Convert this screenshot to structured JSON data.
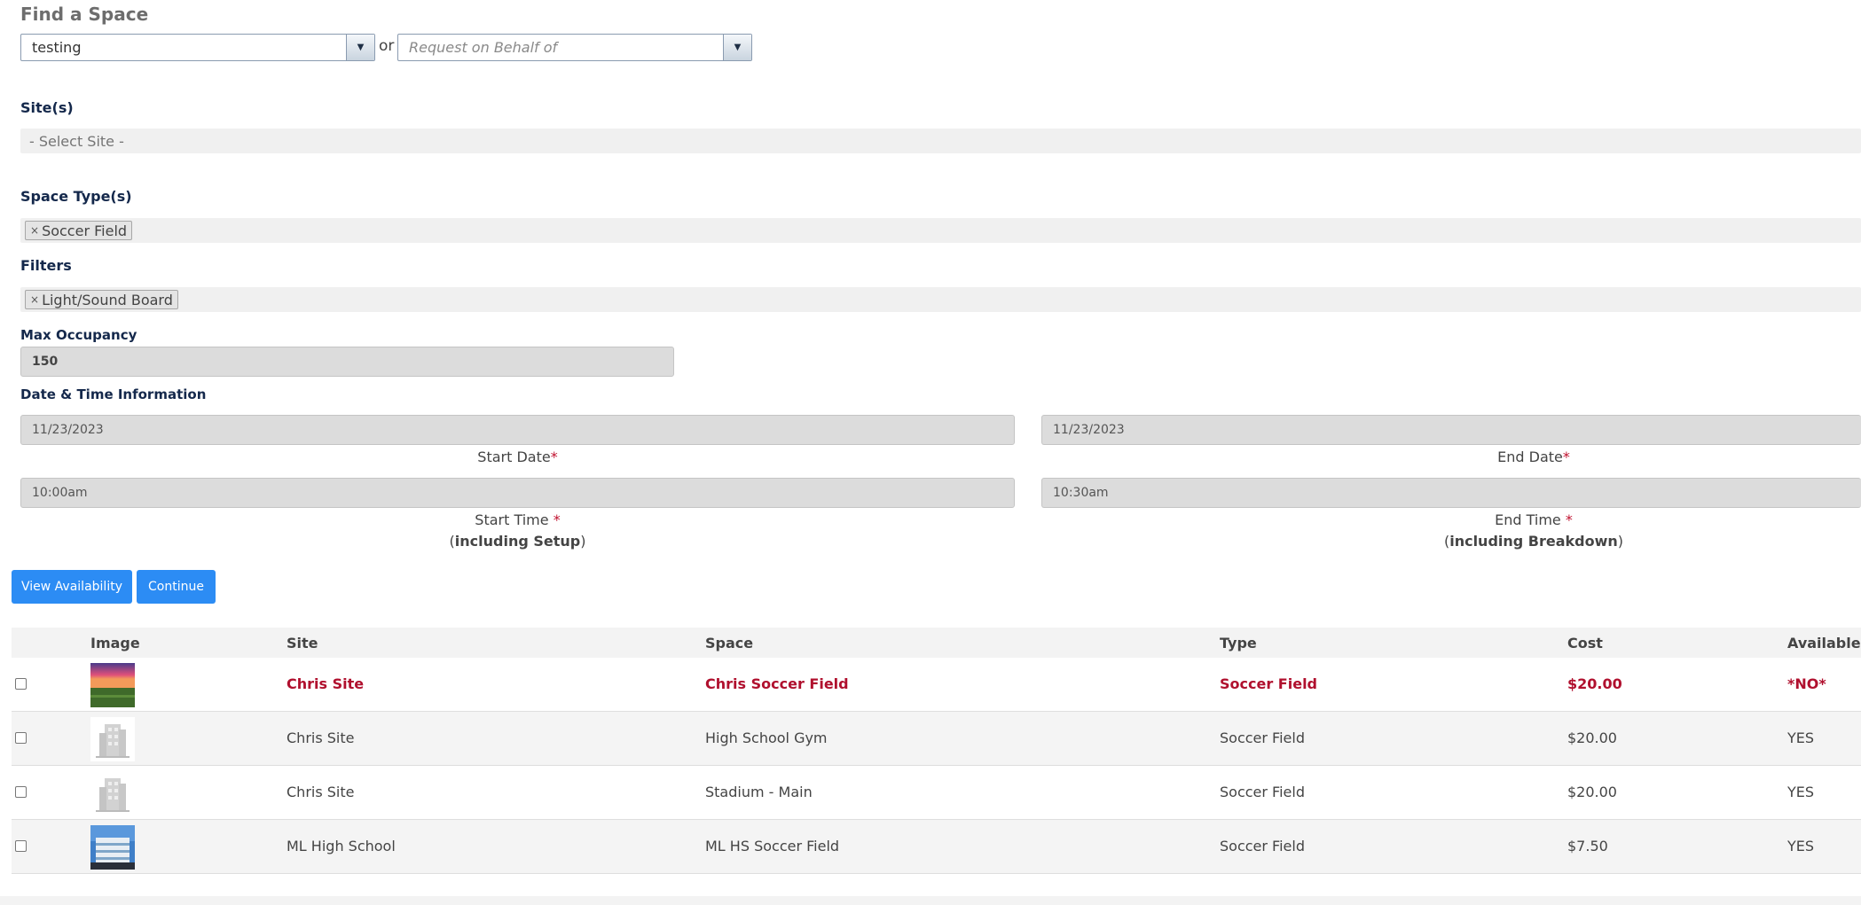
{
  "page_title": "Find a Space",
  "requester": {
    "value": "testing",
    "or_text": "or",
    "behalf_placeholder": "Request on Behalf of"
  },
  "sites": {
    "label": "Site(s)",
    "placeholder": "- Select Site -"
  },
  "space_types": {
    "label": "Space Type(s)",
    "chips": [
      "Soccer Field"
    ]
  },
  "filters": {
    "label": "Filters",
    "chips": [
      "Light/Sound Board"
    ]
  },
  "max_occupancy": {
    "label": "Max Occupancy",
    "value": "150"
  },
  "datetime": {
    "label": "Date & Time Information",
    "start_date": "11/23/2023",
    "end_date": "11/23/2023",
    "start_date_label": "Start Date",
    "end_date_label": "End Date",
    "start_time": "10:00am",
    "end_time": "10:30am",
    "start_time_label": "Start Time ",
    "end_time_label": "End Time ",
    "start_time_note": "including Setup",
    "end_time_note": "including Breakdown",
    "required_mark": "*"
  },
  "buttons": {
    "view_availability": "View Availability",
    "continue": "Continue"
  },
  "table": {
    "headers": {
      "image": "Image",
      "site": "Site",
      "space": "Space",
      "type": "Type",
      "cost": "Cost",
      "available": "Available"
    },
    "rows": [
      {
        "site": "Chris Site",
        "space": "Chris Soccer Field",
        "type": "Soccer Field",
        "cost": "$20.00",
        "available": "*NO*",
        "image": "sunset-field-photo"
      },
      {
        "site": "Chris Site",
        "space": "High School Gym",
        "type": "Soccer Field",
        "cost": "$20.00",
        "available": "YES",
        "image": "building-placeholder-icon"
      },
      {
        "site": "Chris Site",
        "space": "Stadium - Main",
        "type": "Soccer Field",
        "cost": "$20.00",
        "available": "YES",
        "image": "building-placeholder-icon"
      },
      {
        "site": "ML High School",
        "space": "ML HS Soccer Field",
        "type": "Soccer Field",
        "cost": "$7.50",
        "available": "YES",
        "image": "school-building-photo"
      }
    ]
  },
  "colors": {
    "primary_button": "#2c8cf4",
    "label_navy": "#14284b",
    "unavailable_red": "#b0102e"
  }
}
